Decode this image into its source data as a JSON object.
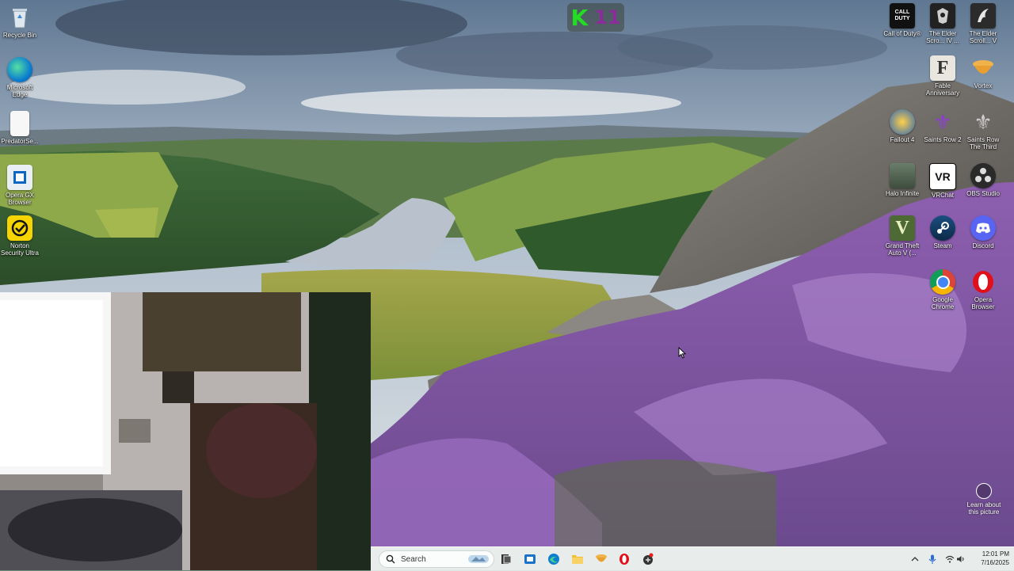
{
  "desktop": {
    "left_icons": [
      {
        "label": "Recycle Bin",
        "icon": "recycle-bin-icon"
      },
      {
        "label": "Microsoft Edge",
        "icon": "edge-icon"
      },
      {
        "label": "PredatorSe...",
        "icon": "file-icon"
      },
      {
        "label": "Opera GX Browser",
        "icon": "opera-gx-icon"
      },
      {
        "label": "Norton Security Ultra",
        "icon": "norton-icon"
      }
    ],
    "right_icons": [
      {
        "label": "Call of Duty®",
        "icon": "call-of-duty-icon",
        "glyph": "CALL OF DUTY"
      },
      {
        "label": "The Elder Scro... IV ...",
        "icon": "elder-scrolls-iv-icon"
      },
      {
        "label": "The Elder Scroll... V",
        "icon": "elder-scrolls-v-icon"
      },
      {
        "label": "Fable Anniversary",
        "icon": "fable-icon",
        "glyph": "F"
      },
      {
        "label": "Vortex",
        "icon": "vortex-icon"
      },
      {
        "label": "Fallout 4",
        "icon": "fallout4-icon"
      },
      {
        "label": "Saints Row 2",
        "icon": "saints-row2-icon"
      },
      {
        "label": "Saints Row The Third",
        "icon": "saints-row-third-icon"
      },
      {
        "label": "Halo Infinite",
        "icon": "halo-icon"
      },
      {
        "label": "VRChat",
        "icon": "vrchat-icon",
        "glyph": "VR"
      },
      {
        "label": "OBS Studio",
        "icon": "obs-icon"
      },
      {
        "label": "Grand Theft Auto V (...",
        "icon": "gta5-icon",
        "glyph": "V"
      },
      {
        "label": "Steam",
        "icon": "steam-icon"
      },
      {
        "label": "Discord",
        "icon": "discord-icon"
      },
      {
        "label": "Google Chrome",
        "icon": "chrome-icon"
      },
      {
        "label": "Opera Browser",
        "icon": "opera-icon"
      }
    ],
    "overlay_badge": {
      "letter": "K",
      "number": "11"
    },
    "learn_picture": "Learn about this picture"
  },
  "taskbar": {
    "search_placeholder": "Search",
    "pinned": [
      "task-view-icon",
      "store-icon",
      "edge-icon",
      "file-explorer-icon",
      "vortex-icon",
      "opera-icon",
      "game-icon"
    ],
    "tray": [
      "chevron-up-icon",
      "microphone-icon",
      "wifi-icon",
      "volume-icon",
      "battery-icon"
    ],
    "time": "12:01 PM",
    "date": "7/16/2025"
  },
  "colors": {
    "k_green": "#22dd22",
    "eleven_purple": "#8a2d9a",
    "taskbar_bg": "#e8eeec"
  }
}
